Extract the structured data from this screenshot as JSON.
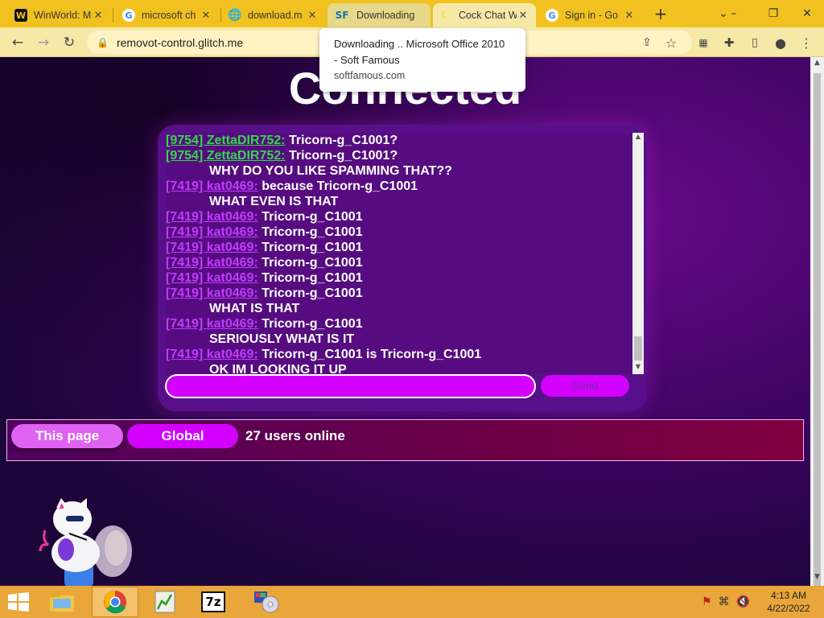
{
  "browser": {
    "tabs": [
      {
        "title": "WinWorld: M",
        "icon": "winworld-icon"
      },
      {
        "title": "microsoft ch",
        "icon": "google-icon"
      },
      {
        "title": "download.m",
        "icon": "globe-icon"
      },
      {
        "title": "Downloading",
        "icon": "softfamous-icon"
      },
      {
        "title": "Cock Chat W",
        "icon": "moon-icon"
      },
      {
        "title": "Sign in - Go",
        "icon": "google-icon"
      }
    ],
    "new_tab_label": "+",
    "url": "removot-control.glitch.me",
    "tooltip": {
      "title": "Downloading .. Microsoft Office 2010 - Soft Famous",
      "domain": "softfamous.com"
    }
  },
  "page": {
    "heading": "Connected",
    "chat": {
      "messages": [
        {
          "user": "[9754] ZettaDIR752:",
          "text": "Tricorn-g_C1001?",
          "color": "#32d74b"
        },
        {
          "user": "[9754] ZettaDIR752:",
          "text": "Tricorn-g_C1001?",
          "color": "#32d74b"
        },
        {
          "user": "",
          "text": "WHY DO YOU LIKE SPAMMING THAT??",
          "color": ""
        },
        {
          "user": "[7419] kat0469:",
          "text": "because Tricorn-g_C1001",
          "color": "#c03cff"
        },
        {
          "user": "",
          "text": "WHAT EVEN IS THAT",
          "color": ""
        },
        {
          "user": "[7419] kat0469:",
          "text": "Tricorn-g_C1001",
          "color": "#c03cff"
        },
        {
          "user": "[7419] kat0469:",
          "text": "Tricorn-g_C1001",
          "color": "#c03cff"
        },
        {
          "user": "[7419] kat0469:",
          "text": "Tricorn-g_C1001",
          "color": "#c03cff"
        },
        {
          "user": "[7419] kat0469:",
          "text": "Tricorn-g_C1001",
          "color": "#c03cff"
        },
        {
          "user": "[7419] kat0469:",
          "text": "Tricorn-g_C1001",
          "color": "#c03cff"
        },
        {
          "user": "[7419] kat0469:",
          "text": "Tricorn-g_C1001",
          "color": "#c03cff"
        },
        {
          "user": "",
          "text": "WHAT IS THAT",
          "color": ""
        },
        {
          "user": "[7419] kat0469:",
          "text": "Tricorn-g_C1001",
          "color": "#c03cff"
        },
        {
          "user": "",
          "text": "SERIOUSLY WHAT IS IT",
          "color": ""
        },
        {
          "user": "[7419] kat0469:",
          "text": "Tricorn-g_C1001 is Tricorn-g_C1001",
          "color": "#c03cff"
        },
        {
          "user": "",
          "text": "OK IM LOOKING IT UP",
          "color": ""
        }
      ],
      "input_value": "",
      "send_label": "Send"
    },
    "rooms": {
      "this_page_label": "This page",
      "global_label": "Global",
      "users_online": "27 users online"
    }
  },
  "taskbar": {
    "apps": [
      "file-explorer-icon",
      "chrome-icon",
      "chart-app-icon",
      "7zip-icon",
      "media-app-icon"
    ],
    "seven_zip_label": "7z",
    "time": "4:13 AM",
    "date": "4/22/2022"
  },
  "colors": {
    "accent": "#d400ff",
    "panel": "#58108a",
    "taskbar": "#e9a63a",
    "chrome": "#f1c21f"
  }
}
